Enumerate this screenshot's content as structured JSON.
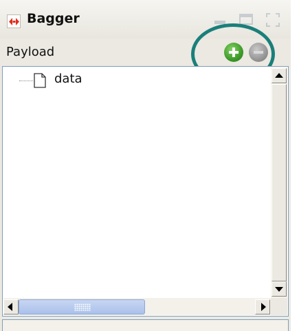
{
  "panel": {
    "title": "Bagger",
    "app_icon": "bagger-logo-icon",
    "window_buttons": [
      "minimize-icon",
      "restore-icon",
      "maximize-icon"
    ]
  },
  "payload": {
    "label": "Payload",
    "add_icon": "add-circle-icon",
    "remove_icon": "remove-circle-icon",
    "accent_green": "#3d9a2a",
    "highlight_color": "#1a7f7a"
  },
  "tree": {
    "items": [
      {
        "label": "data",
        "icon": "file-icon"
      }
    ]
  },
  "scrollbars": {
    "up_icon": "arrow-up-icon",
    "down_icon": "arrow-down-icon",
    "left_icon": "arrow-left-icon",
    "right_icon": "arrow-right-icon"
  }
}
